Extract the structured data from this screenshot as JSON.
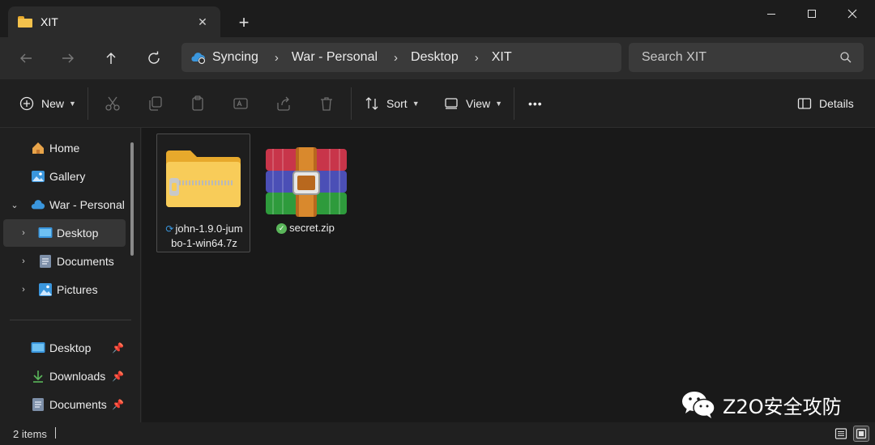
{
  "window": {
    "tab_title": "XIT",
    "tab_close": "✕",
    "new_tab": "+"
  },
  "address": {
    "segments": [
      "Syncing",
      "War - Personal",
      "Desktop",
      "XIT"
    ],
    "separator": "›",
    "search_placeholder": "Search XIT"
  },
  "commands": {
    "new_label": "New",
    "sort_label": "Sort",
    "view_label": "View",
    "more_label": "•••",
    "details_label": "Details"
  },
  "sidebar": {
    "items": [
      {
        "label": "Home",
        "icon": "home-icon"
      },
      {
        "label": "Gallery",
        "icon": "gallery-icon"
      },
      {
        "label": "War - Personal",
        "icon": "onedrive-cloud-icon"
      },
      {
        "label": "Desktop",
        "icon": "desktop-folder-icon"
      },
      {
        "label": "Documents",
        "icon": "documents-folder-icon"
      },
      {
        "label": "Pictures",
        "icon": "pictures-folder-icon"
      }
    ],
    "pinned": [
      {
        "label": "Desktop",
        "icon": "desktop-folder-icon"
      },
      {
        "label": "Downloads",
        "icon": "downloads-icon"
      },
      {
        "label": "Documents",
        "icon": "documents-folder-icon"
      }
    ]
  },
  "files": [
    {
      "name_line1": "john-1.9.0-jum",
      "name_line2": "bo-1-win64.7z",
      "icon": "zip-folder-icon",
      "status": "sync-pending-icon"
    },
    {
      "name": "secret.zip",
      "icon": "winrar-archive-icon",
      "status": "synced-check-icon"
    }
  ],
  "status": {
    "item_count": "2 items"
  },
  "watermark": {
    "text": "Z2O安全攻防",
    "logo": "wechat-logo"
  },
  "colors": {
    "accent": "#3a96dd",
    "folder": "#f4c24c",
    "synced": "#5ab65a"
  }
}
